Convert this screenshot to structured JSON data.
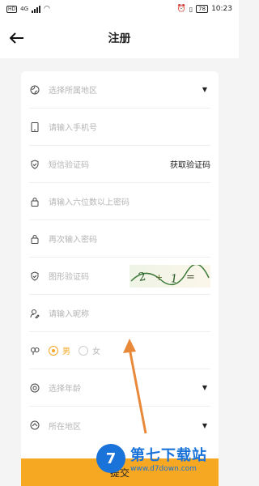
{
  "status_bar": {
    "left_badge": "HD",
    "network": "4G",
    "battery": "78",
    "time": "10:23"
  },
  "header": {
    "back_icon": "arrow-left-icon",
    "title": "注册"
  },
  "form": {
    "region": {
      "placeholder": "选择所属地区",
      "icon": "globe-icon"
    },
    "phone": {
      "placeholder": "请输入手机号",
      "icon": "phone-icon"
    },
    "sms": {
      "placeholder": "短信验证码",
      "icon": "shield-icon",
      "button": "获取验证码"
    },
    "password": {
      "placeholder": "请输入六位数以上密码",
      "icon": "lock-icon"
    },
    "password_confirm": {
      "placeholder": "再次输入密码",
      "icon": "lock-icon"
    },
    "captcha": {
      "placeholder": "图形验证码",
      "icon": "shield-icon"
    },
    "nickname": {
      "placeholder": "请输入昵称",
      "icon": "user-edit-icon"
    },
    "gender": {
      "icon": "gender-icon",
      "options": [
        "男",
        "女"
      ],
      "selected": "男"
    },
    "age": {
      "placeholder": "选择年龄",
      "icon": "calendar-icon"
    },
    "location": {
      "placeholder": "所在地区",
      "icon": "location-icon"
    }
  },
  "submit": {
    "label": "提交"
  },
  "watermark": {
    "title": "第七下载站",
    "url": "www.d7down.com"
  },
  "colors": {
    "accent": "#f5a623",
    "submit_bg": "#f7a823",
    "watermark": "#1a73d9"
  }
}
